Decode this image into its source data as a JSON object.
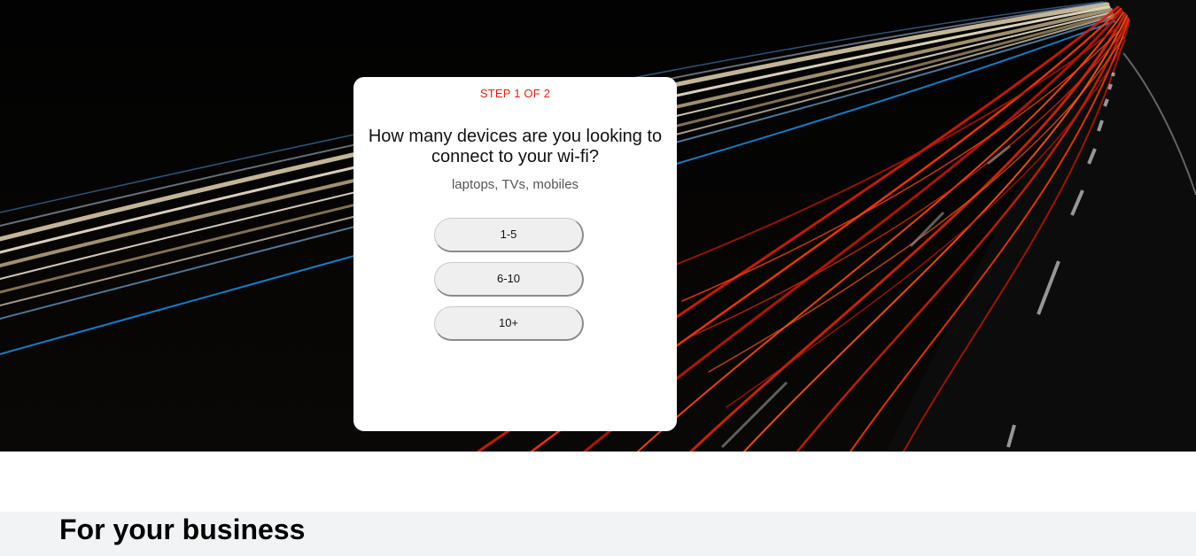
{
  "hero": {
    "image": "highway-light-trails-night"
  },
  "quiz": {
    "step_label": "STEP 1 OF 2",
    "question": "How many devices are you looking to connect to your wi-fi?",
    "hint": "laptops, TVs, mobiles",
    "options": [
      "1-5",
      "6-10",
      "10+"
    ]
  },
  "section": {
    "heading": "For your business"
  },
  "colors": {
    "step_accent": "#e31b13",
    "section_bg": "#f2f3f5"
  }
}
